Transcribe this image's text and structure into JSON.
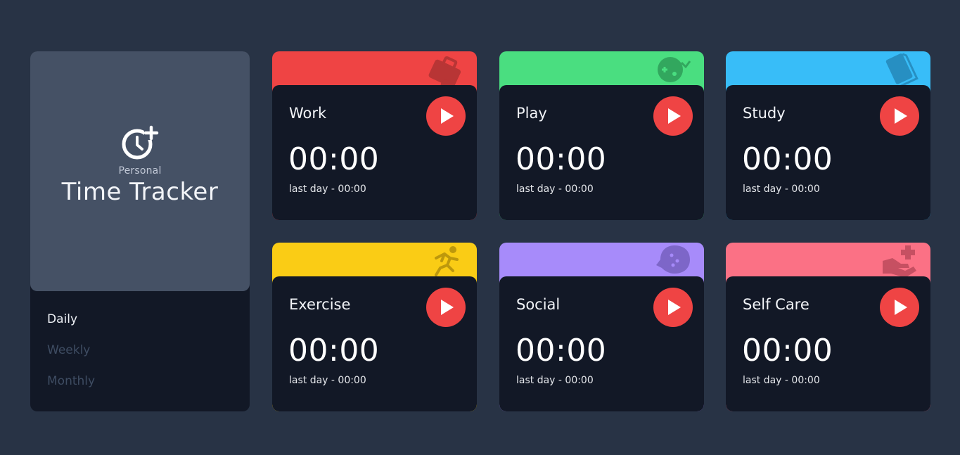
{
  "profile": {
    "subtitle": "Personal",
    "title": "Time Tracker",
    "icon": "clock-plus-icon"
  },
  "periods": [
    {
      "label": "Daily",
      "active": true
    },
    {
      "label": "Weekly",
      "active": false
    },
    {
      "label": "Monthly",
      "active": false
    }
  ],
  "cards": [
    {
      "title": "Work",
      "time": "00:00",
      "last": "last day - 00:00",
      "color": "#ef4444",
      "icon": "briefcase-icon"
    },
    {
      "title": "Play",
      "time": "00:00",
      "last": "last day - 00:00",
      "color": "#4ade80",
      "icon": "gamepad-icon"
    },
    {
      "title": "Study",
      "time": "00:00",
      "last": "last day - 00:00",
      "color": "#38bdf8",
      "icon": "book-icon"
    },
    {
      "title": "Exercise",
      "time": "00:00",
      "last": "last day - 00:00",
      "color": "#facc15",
      "icon": "running-icon"
    },
    {
      "title": "Social",
      "time": "00:00",
      "last": "last day - 00:00",
      "color": "#a78bfa",
      "icon": "chat-bubble-icon"
    },
    {
      "title": "Self Care",
      "time": "00:00",
      "last": "last day - 00:00",
      "color": "#fb7185",
      "icon": "hand-care-icon"
    }
  ],
  "colors": {
    "page_bg": "#283345",
    "panel_bg": "#121826",
    "profile_bg": "#455165",
    "play_button": "#ef4444"
  }
}
